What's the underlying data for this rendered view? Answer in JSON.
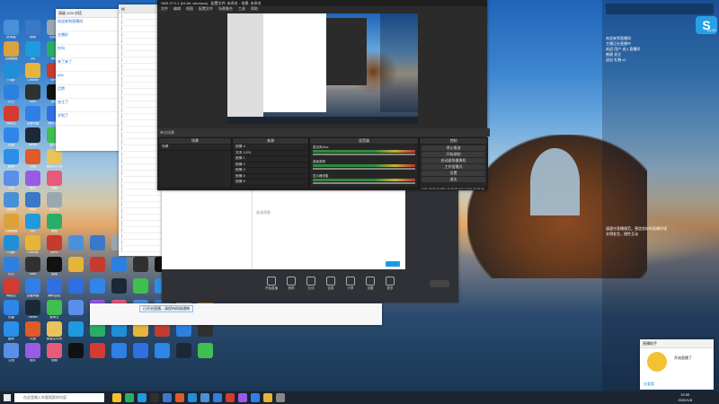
{
  "desktop_icons": [
    {
      "label": "此电脑",
      "color": "#4a90d9"
    },
    {
      "label": "网络",
      "color": "#3c78c8"
    },
    {
      "label": "回收站",
      "color": "#9aa7b0"
    },
    {
      "label": "控制面板",
      "color": "#d9a23c"
    },
    {
      "label": "QQ",
      "color": "#1e9bde"
    },
    {
      "label": "微信",
      "color": "#2aae67"
    },
    {
      "label": "Edge",
      "color": "#1f8fd8"
    },
    {
      "label": "Chrome",
      "color": "#e7b43a"
    },
    {
      "label": "WPS",
      "color": "#c53b2f"
    },
    {
      "label": "钉钉",
      "color": "#2d7fe0"
    },
    {
      "label": "OBS",
      "color": "#303030"
    },
    {
      "label": "剪映",
      "color": "#111111"
    },
    {
      "label": "网易云",
      "color": "#d33a31"
    },
    {
      "label": "百度网盘",
      "color": "#2f7fe6"
    },
    {
      "label": "腾讯会议",
      "color": "#2f6fe0"
    },
    {
      "label": "迅雷",
      "color": "#2f86e8"
    },
    {
      "label": "Steam",
      "color": "#1b2838"
    },
    {
      "label": "爱奇艺",
      "color": "#3fbf4f"
    },
    {
      "label": "酷狗",
      "color": "#2b8ee8"
    },
    {
      "label": "火绒",
      "color": "#e05a2a"
    },
    {
      "label": "新建文件夹",
      "color": "#e8c35a"
    },
    {
      "label": "文档",
      "color": "#5a8fe8"
    },
    {
      "label": "图片",
      "color": "#9a5ae8"
    },
    {
      "label": "视频",
      "color": "#e85a7a"
    }
  ],
  "obs": {
    "title": "OBS 27.0.1 (64-bit, windows) - 配置文件: 未命名 - 场景: 未命名",
    "menu": [
      "文件",
      "编辑",
      "视图",
      "配置文件",
      "场景集合",
      "工具",
      "帮助"
    ],
    "panels": {
      "scenes": "场景",
      "sources": "来源",
      "mixer": "混音器",
      "transitions": "转场",
      "controls": "控制"
    },
    "scene_items": [
      "场景"
    ],
    "source_items": [
      "图像 4",
      "文本 1/2/3",
      "图像 1",
      "图像 2",
      "图像 3",
      "图像 5",
      "图像 6"
    ],
    "mixer_items": [
      "麦克风/Aux",
      "桌面音频",
      "显示器采集"
    ],
    "controls": [
      "停止推流",
      "开始录制",
      "启动虚拟摄像机",
      "工作室模式",
      "设置",
      "退出"
    ],
    "status": "LIVE: 00:35:12   REC: 00:00:00   CPU: 8.5%, 30.00 fps"
  },
  "chat_window": {
    "title": "高级 1/24 对话",
    "messages": [
      "欢迎来到直播间",
      "主播好",
      "在吗",
      "来了来了",
      "666",
      "点赞",
      "关注了",
      "学到了"
    ],
    "input_placeholder": "发送消息"
  },
  "live_window": {
    "title": "直播",
    "tools": [
      "开始直播",
      "美颜",
      "互动",
      "连麦",
      "分享",
      "设置",
      "更多"
    ],
    "notice": "已开启直播，请保持网络通畅"
  },
  "right_overlay": {
    "badge": "43.2K",
    "lines": [
      "欢迎来到直播间",
      "主播正在直播中",
      "欢迎 用户 进入直播间",
      "感谢 关注",
      "送出 礼物 x1"
    ],
    "bottom": [
      "请遵守直播规范，营造良好的直播环境",
      "文明发言，理性互动"
    ]
  },
  "notify": {
    "title": "直播助手",
    "text": "开始直播了",
    "action": "去看看"
  },
  "taskbar": {
    "search": "在这里输入你要搜索的内容",
    "time": "19:30",
    "date": "2022/1/8"
  }
}
